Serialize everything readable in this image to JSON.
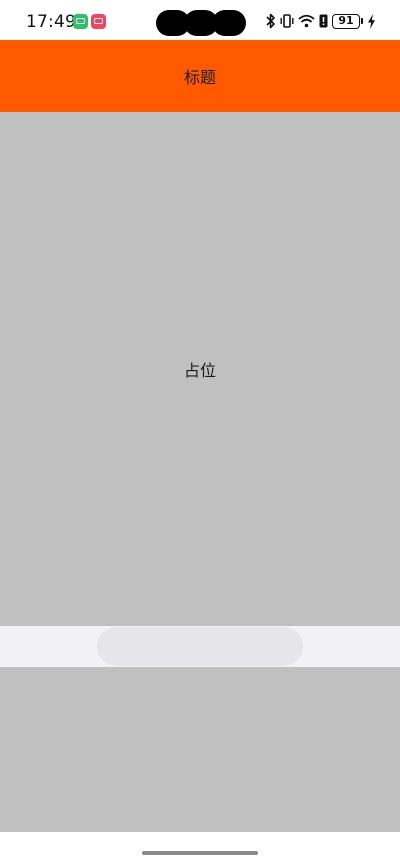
{
  "status_bar": {
    "time": "17:49",
    "battery_level": "91",
    "notification_icons": [
      "green-app-icon",
      "pink-app-icon"
    ],
    "system_icons": [
      "bluetooth-icon",
      "vibrate-icon",
      "wifi-icon",
      "alert-icon",
      "battery-icon",
      "charging-icon"
    ]
  },
  "header": {
    "title": "标题",
    "background_color": "#ff5a00"
  },
  "main": {
    "placeholder_label": "占位",
    "background_color": "#c0c0c0"
  },
  "input_bar": {
    "background_color": "#f2f2f5",
    "pill_color": "#e6e6ea"
  }
}
